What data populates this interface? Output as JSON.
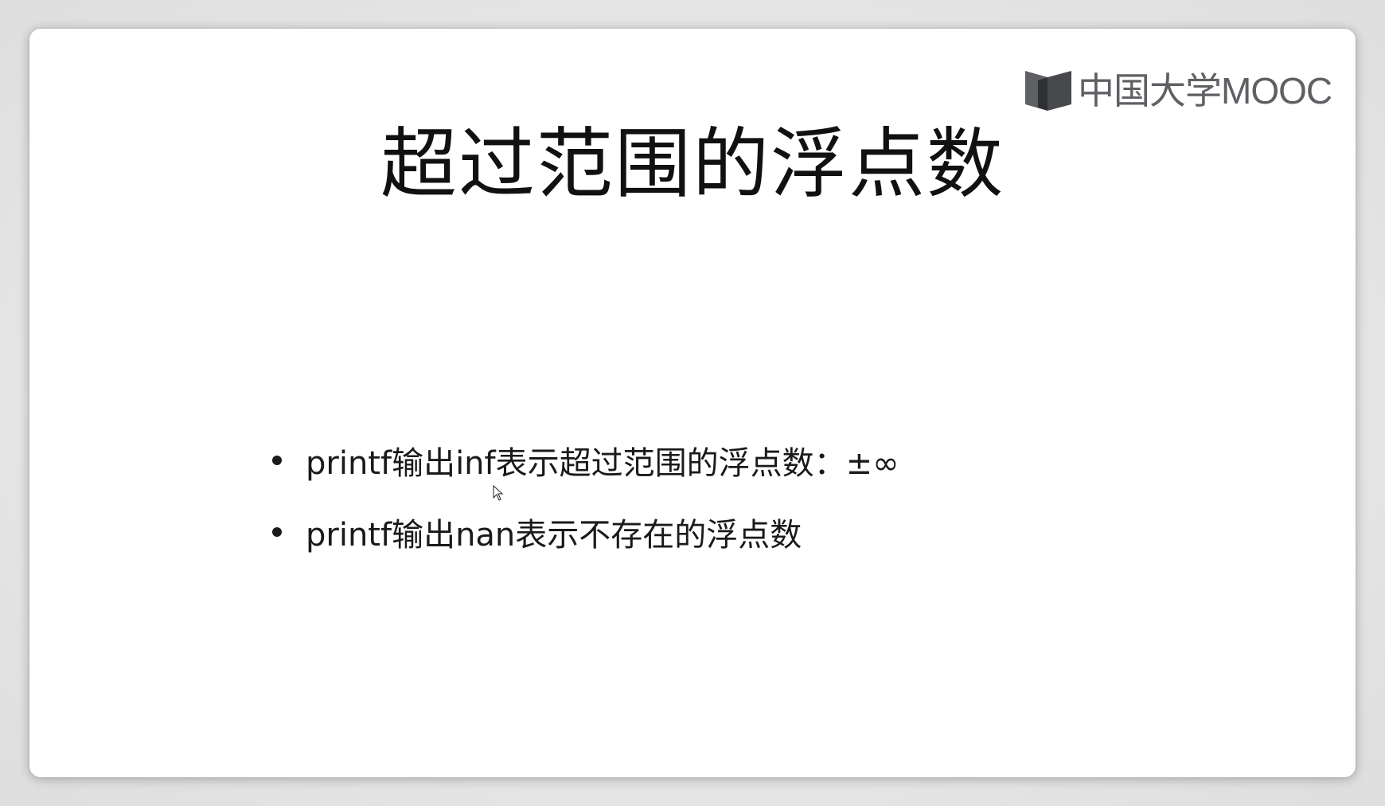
{
  "logo": {
    "text": "中国大学MOOC",
    "icon": "book-logo-icon",
    "color": "#5f6064"
  },
  "slide": {
    "title": "超过范围的浮点数",
    "bullets": [
      {
        "text": "printf输出inf表示超过范围的浮点数：±∞"
      },
      {
        "text": "printf输出nan表示不存在的浮点数"
      }
    ]
  },
  "colors": {
    "background": "#e9e9e9",
    "slide": "#ffffff",
    "text": "#111111"
  }
}
